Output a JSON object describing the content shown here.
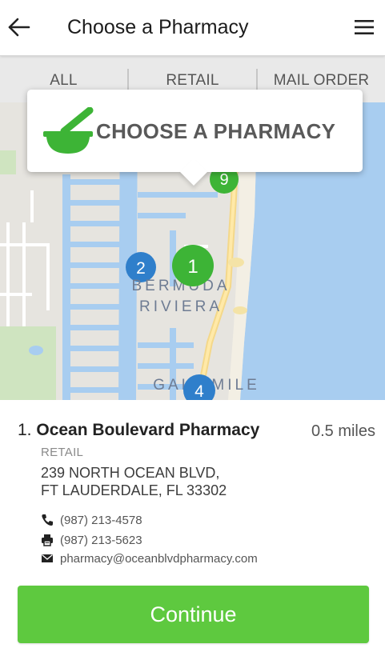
{
  "header": {
    "title": "Choose a Pharmacy",
    "back_icon": "arrow-left-icon",
    "menu_icon": "hamburger-menu-icon"
  },
  "tabs": [
    {
      "label": "ALL"
    },
    {
      "label": "RETAIL"
    },
    {
      "label": "MAIL ORDER"
    }
  ],
  "map": {
    "callout_text": "CHOOSE A PHARMACY",
    "callout_icon": "mortar-pestle-icon",
    "labels": [
      "BERMUDA",
      "RIVIERA",
      "GALT MILE"
    ],
    "markers": [
      {
        "label": "1",
        "color": "#3db436"
      },
      {
        "label": "2",
        "color": "#2f7fcb"
      },
      {
        "label": "4",
        "color": "#2f7fcb"
      },
      {
        "label": "9",
        "color": "#3db436"
      }
    ]
  },
  "pharmacy": {
    "index": "1.",
    "name": "Ocean Boulevard Pharmacy",
    "distance": "0.5 miles",
    "type": "RETAIL",
    "address_line1": "239 NORTH OCEAN BLVD,",
    "address_line2": "FT LAUDERDALE, FL 33302",
    "phone": "(987) 213-4578",
    "fax": "(987) 213-5623",
    "email": "pharmacy@oceanblvdpharmacy.com"
  },
  "continue_label": "Continue",
  "colors": {
    "accent": "#5ec93f",
    "marker_blue": "#2f7fcb",
    "marker_green": "#3db436",
    "water": "#a8cdf0"
  }
}
